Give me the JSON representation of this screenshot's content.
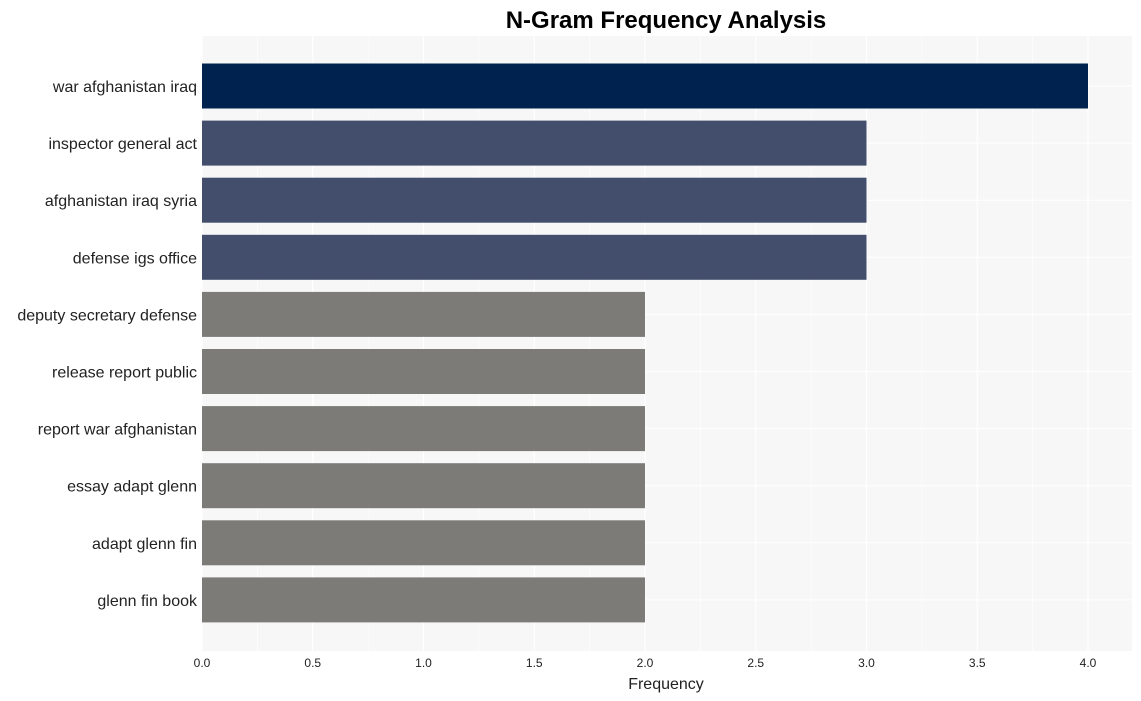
{
  "chart_data": {
    "type": "bar",
    "orientation": "horizontal",
    "title": "N-Gram Frequency Analysis",
    "xlabel": "Frequency",
    "ylabel": "",
    "xlim": [
      0,
      4.2
    ],
    "xticks": [
      "0.0",
      "0.5",
      "1.0",
      "1.5",
      "2.0",
      "2.5",
      "3.0",
      "3.5",
      "4.0"
    ],
    "grid": true,
    "categories": [
      "war afghanistan iraq",
      "inspector general act",
      "afghanistan iraq syria",
      "defense igs office",
      "deputy secretary defense",
      "release report public",
      "report war afghanistan",
      "essay adapt glenn",
      "adapt glenn fin",
      "glenn fin book"
    ],
    "values": [
      4,
      3,
      3,
      3,
      2,
      2,
      2,
      2,
      2,
      2
    ],
    "colors": {
      "4": "#00224e",
      "3": "#434e6c",
      "2": "#7c7b78"
    },
    "background": "#f7f7f7",
    "gridline_color": "#ffffff"
  }
}
